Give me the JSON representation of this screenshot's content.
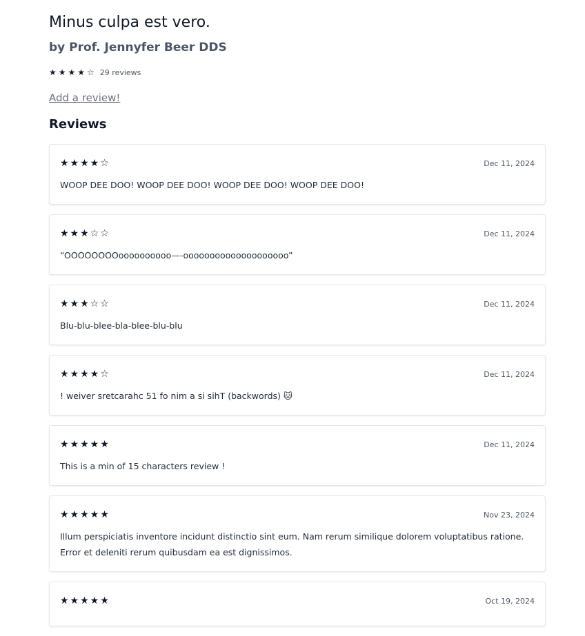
{
  "book": {
    "title": "Minus culpa est vero.",
    "author": "by Prof. Jennyfer Beer DDS",
    "rating_stars": "★★★★☆",
    "review_count": "29 reviews"
  },
  "add_review_label": "Add a review!",
  "reviews_heading": "Reviews",
  "reviews": [
    {
      "stars": "★★★★☆",
      "date": "Dec 11, 2024",
      "text": "WOOP DEE DOO! WOOP DEE DOO! WOOP DEE DOO! WOOP DEE DOO!"
    },
    {
      "stars": "★★★☆☆",
      "date": "Dec 11, 2024",
      "text": "“OOOOOOOOoooooooooo—-oooooooooooooooooooo”"
    },
    {
      "stars": "★★★☆☆",
      "date": "Dec 11, 2024",
      "text": "Blu-blu-blee-bla-blee-blu-blu"
    },
    {
      "stars": "★★★★☆",
      "date": "Dec 11, 2024",
      "text": "! weiver sretcarahc 51 fo nim a si sihT (backwords) 🐱"
    },
    {
      "stars": "★★★★★",
      "date": "Dec 11, 2024",
      "text": "This is a min of 15 characters review !"
    },
    {
      "stars": "★★★★★",
      "date": "Nov 23, 2024",
      "text": "Illum perspiciatis inventore incidunt distinctio sint eum. Nam rerum similique dolorem voluptatibus ratione. Error et deleniti rerum quibusdam ea est dignissimos."
    },
    {
      "stars": "★★★★★",
      "date": "Oct 19, 2024",
      "text": ""
    }
  ]
}
